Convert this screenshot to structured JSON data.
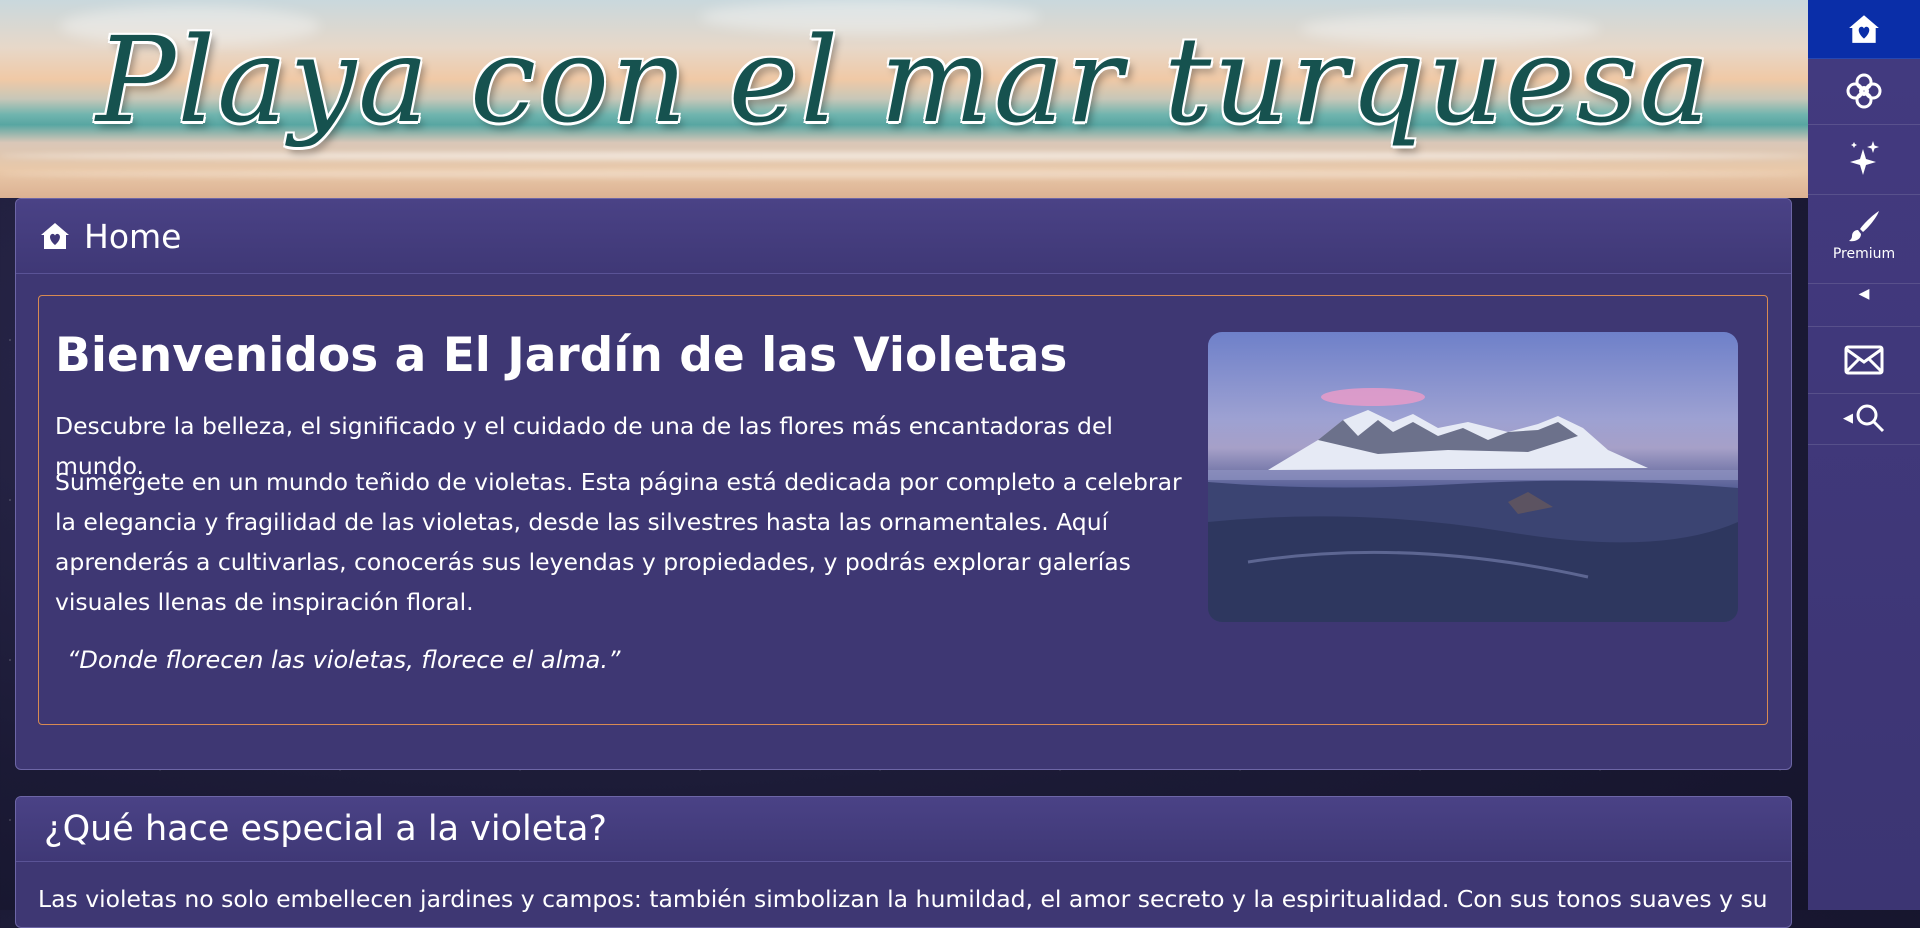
{
  "banner": {
    "title": "Playa con el mar turquesa"
  },
  "rail": {
    "items": [
      {
        "icon": "home-heart-icon",
        "active": true
      },
      {
        "icon": "flower-icon"
      },
      {
        "icon": "sparkles-icon"
      },
      {
        "icon": "brush-icon",
        "label": "Premium"
      },
      {
        "icon": "envelope-icon"
      },
      {
        "icon": "search-icon"
      }
    ],
    "active_color": "#0a2ea8"
  },
  "home_panel": {
    "header": "Home",
    "hero": {
      "title": "Bienvenidos a El Jardín de las Violetas",
      "subtitle": "Descubre la belleza, el significado y el cuidado de una de las flores más encantadoras del mundo.",
      "body": "Sumérgete en un mundo teñido de violetas. Esta página está dedicada por completo a celebrar la elegancia y fragilidad de las violetas, desde las silvestres hasta las ornamentales. Aquí aprenderás a cultivarlas, conocerás sus leyendas y propiedades, y podrás explorar galerías visuales llenas de inspiración floral.",
      "quote": "“Donde florecen las violetas, florece el alma.”"
    },
    "border_color": "#d78a52"
  },
  "special_panel": {
    "header": "¿Qué hace especial a la violeta?",
    "text": "Las violetas no solo embellecen jardines y campos: también simbolizan la humildad, el amor secreto y la espiritualidad. Con sus tonos suaves y su"
  },
  "colors": {
    "panel_bg": "#3e3773",
    "rail_bg": "#433a80",
    "banner_title": "#16524f"
  }
}
